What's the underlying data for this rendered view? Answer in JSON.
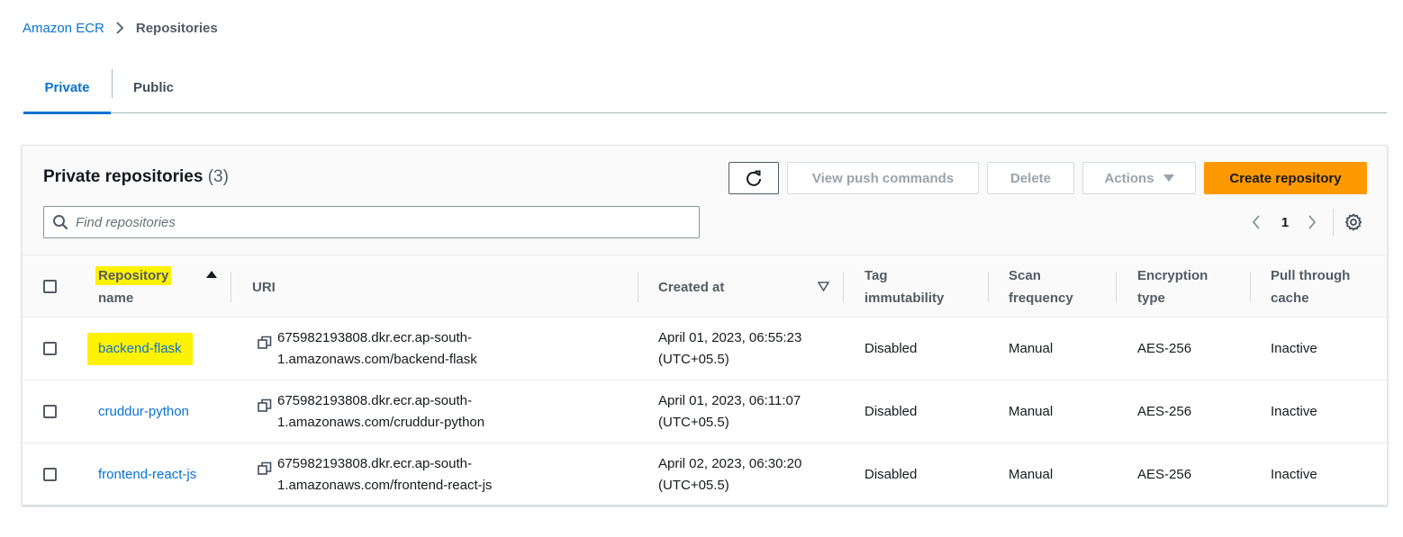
{
  "breadcrumb": {
    "root": "Amazon ECR",
    "current": "Repositories"
  },
  "tabs": [
    {
      "label": "Private",
      "selected": true
    },
    {
      "label": "Public",
      "selected": false
    }
  ],
  "panel": {
    "title": "Private repositories",
    "count": "(3)"
  },
  "toolbar": {
    "refresh_icon": "refresh-icon",
    "view_push_commands": "View push commands",
    "delete": "Delete",
    "actions": "Actions",
    "create_repository": "Create repository"
  },
  "search": {
    "placeholder": "Find repositories",
    "value": ""
  },
  "pagination": {
    "current_page": "1"
  },
  "table": {
    "columns": {
      "name_line1": "Repository",
      "name_line2": "name",
      "uri": "URI",
      "created_at": "Created at",
      "tag_line1": "Tag",
      "tag_line2": "immutability",
      "scan_line1": "Scan",
      "scan_line2": "frequency",
      "enc_line1": "Encryption",
      "enc_line2": "type",
      "pull_line1": "Pull through",
      "pull_line2": "cache"
    },
    "rows": [
      {
        "name": "backend-flask",
        "uri_line1": "675982193808.dkr.ecr.ap-south-",
        "uri_line2": "1.amazonaws.com/backend-flask",
        "created_line1": "April 01, 2023, 06:55:23",
        "created_line2": "(UTC+05.5)",
        "tag_immutability": "Disabled",
        "scan_frequency": "Manual",
        "encryption_type": "AES-256",
        "pull_through_cache": "Inactive"
      },
      {
        "name": "cruddur-python",
        "uri_line1": "675982193808.dkr.ecr.ap-south-",
        "uri_line2": "1.amazonaws.com/cruddur-python",
        "created_line1": "April 01, 2023, 06:11:07",
        "created_line2": "(UTC+05.5)",
        "tag_immutability": "Disabled",
        "scan_frequency": "Manual",
        "encryption_type": "AES-256",
        "pull_through_cache": "Inactive"
      },
      {
        "name": "frontend-react-js",
        "uri_line1": "675982193808.dkr.ecr.ap-south-",
        "uri_line2": "1.amazonaws.com/frontend-react-js",
        "created_line1": "April 02, 2023, 06:30:20",
        "created_line2": "(UTC+05.5)",
        "tag_immutability": "Disabled",
        "scan_frequency": "Manual",
        "encryption_type": "AES-256",
        "pull_through_cache": "Inactive"
      }
    ]
  },
  "colors": {
    "link": "#0972d3",
    "primary_button": "#ff9900",
    "highlight": "#fff200"
  }
}
